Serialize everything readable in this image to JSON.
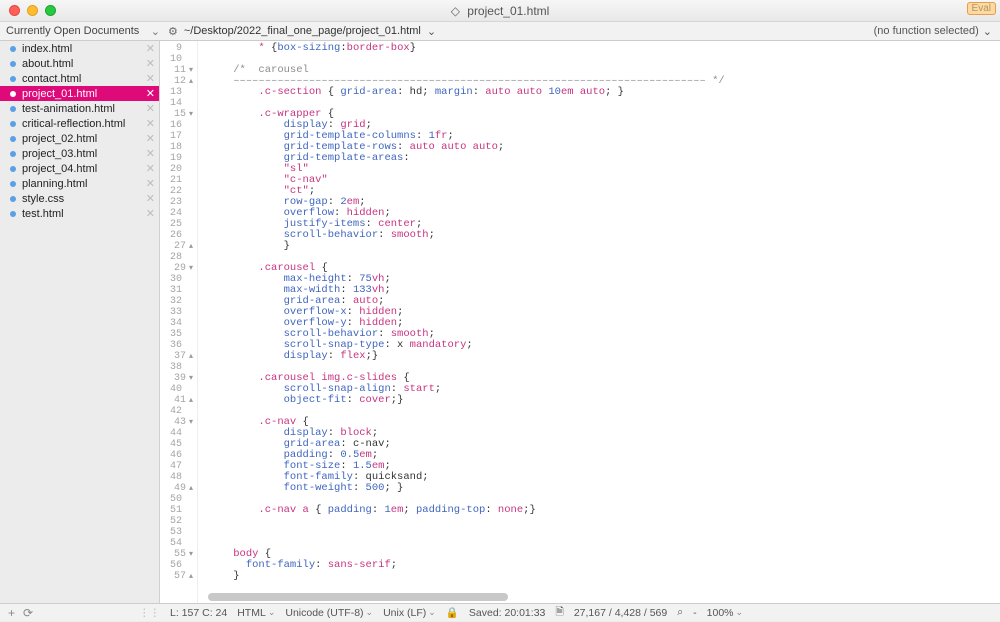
{
  "window": {
    "title": "project_01.html",
    "eval_label": "Eval"
  },
  "toolbar": {
    "sidebar_title": "Currently Open Documents",
    "path": "~/Desktop/2022_final_one_page/project_01.html",
    "func_selector": "(no function selected)"
  },
  "sidebar": {
    "files": [
      {
        "name": "index.html",
        "active": false
      },
      {
        "name": "about.html",
        "active": false
      },
      {
        "name": "contact.html",
        "active": false
      },
      {
        "name": "project_01.html",
        "active": true
      },
      {
        "name": "test-animation.html",
        "active": false
      },
      {
        "name": "critical-reflection.html",
        "active": false
      },
      {
        "name": "project_02.html",
        "active": false
      },
      {
        "name": "project_03.html",
        "active": false
      },
      {
        "name": "project_04.html",
        "active": false
      },
      {
        "name": "planning.html",
        "active": false
      },
      {
        "name": "style.css",
        "active": false
      },
      {
        "name": "test.html",
        "active": false
      }
    ]
  },
  "editor": {
    "first_line": 9,
    "fold_marks": {
      "11": "down",
      "12": "up",
      "15": "down",
      "27": "up",
      "29": "down",
      "37": "up",
      "39": "down",
      "41": "up",
      "43": "down",
      "49": "up",
      "55": "down",
      "57": "up"
    },
    "lines": [
      {
        "n": 9,
        "html": "        <span class='c-sel'>*</span> {<span class='c-prop'>box-sizing</span>:<span class='c-val'>border-box</span>}"
      },
      {
        "n": 10,
        "html": ""
      },
      {
        "n": 11,
        "html": "    <span class='c-com'>/*  carousel</span>"
      },
      {
        "n": 12,
        "html": "    <span class='c-com'>––––––––––––––––––––––––––––––––––––––––––––––––––––––––––––––––––––––––––– */</span>"
      },
      {
        "n": 13,
        "html": "        <span class='c-sel'>.c-section</span> { <span class='c-prop'>grid-area</span>: hd; <span class='c-prop'>margin</span>: <span class='c-val'>auto auto</span> <span class='c-num'>10</span><span class='c-unit'>em</span> <span class='c-val'>auto</span>; }"
      },
      {
        "n": 14,
        "html": ""
      },
      {
        "n": 15,
        "html": "        <span class='c-sel'>.c-wrapper</span> {"
      },
      {
        "n": 16,
        "html": "            <span class='c-prop'>display</span>: <span class='c-val'>grid</span>;"
      },
      {
        "n": 17,
        "html": "            <span class='c-prop'>grid-template-columns</span>: <span class='c-num'>1</span><span class='c-unit'>fr</span>;"
      },
      {
        "n": 18,
        "html": "            <span class='c-prop'>grid-template-rows</span>: <span class='c-val'>auto auto auto</span>;"
      },
      {
        "n": 19,
        "html": "            <span class='c-prop'>grid-template-areas</span>:"
      },
      {
        "n": 20,
        "html": "            <span class='c-str'>\"sl\"</span>"
      },
      {
        "n": 21,
        "html": "            <span class='c-str'>\"c-nav\"</span>"
      },
      {
        "n": 22,
        "html": "            <span class='c-str'>\"ct\"</span>;"
      },
      {
        "n": 23,
        "html": "            <span class='c-prop'>row-gap</span>: <span class='c-num'>2</span><span class='c-unit'>em</span>;"
      },
      {
        "n": 24,
        "html": "            <span class='c-prop'>overflow</span>: <span class='c-val'>hidden</span>;"
      },
      {
        "n": 25,
        "html": "            <span class='c-prop'>justify-items</span>: <span class='c-val'>center</span>;"
      },
      {
        "n": 26,
        "html": "            <span class='c-prop'>scroll-behavior</span>: <span class='c-val'>smooth</span>;"
      },
      {
        "n": 27,
        "html": "            }"
      },
      {
        "n": 28,
        "html": ""
      },
      {
        "n": 29,
        "html": "        <span class='c-sel'>.carousel</span> {"
      },
      {
        "n": 30,
        "html": "            <span class='c-prop'>max-height</span>: <span class='c-num'>75</span><span class='c-unit'>vh</span>;"
      },
      {
        "n": 31,
        "html": "            <span class='c-prop'>max-width</span>: <span class='c-num'>133</span><span class='c-unit'>vh</span>;"
      },
      {
        "n": 32,
        "html": "            <span class='c-prop'>grid-area</span>: <span class='c-val'>auto</span>;"
      },
      {
        "n": 33,
        "html": "            <span class='c-prop'>overflow-x</span>: <span class='c-val'>hidden</span>;"
      },
      {
        "n": 34,
        "html": "            <span class='c-prop'>overflow-y</span>: <span class='c-val'>hidden</span>;"
      },
      {
        "n": 35,
        "html": "            <span class='c-prop'>scroll-behavior</span>: <span class='c-val'>smooth</span>;"
      },
      {
        "n": 36,
        "html": "            <span class='c-prop'>scroll-snap-type</span>: x <span class='c-val'>mandatory</span>;"
      },
      {
        "n": 37,
        "html": "            <span class='c-prop'>display</span>: <span class='c-val'>flex</span>;}"
      },
      {
        "n": 38,
        "html": ""
      },
      {
        "n": 39,
        "html": "        <span class='c-sel'>.carousel img.c-slides</span> {"
      },
      {
        "n": 40,
        "html": "            <span class='c-prop'>scroll-snap-align</span>: <span class='c-val'>start</span>;"
      },
      {
        "n": 41,
        "html": "            <span class='c-prop'>object-fit</span>: <span class='c-val'>cover</span>;}"
      },
      {
        "n": 42,
        "html": ""
      },
      {
        "n": 43,
        "html": "        <span class='c-sel'>.c-nav</span> {"
      },
      {
        "n": 44,
        "html": "            <span class='c-prop'>display</span>: <span class='c-val'>block</span>;"
      },
      {
        "n": 45,
        "html": "            <span class='c-prop'>grid-area</span>: c-nav;"
      },
      {
        "n": 46,
        "html": "            <span class='c-prop'>padding</span>: <span class='c-num'>0.5</span><span class='c-unit'>em</span>;"
      },
      {
        "n": 47,
        "html": "            <span class='c-prop'>font-size</span>: <span class='c-num'>1.5</span><span class='c-unit'>em</span>;"
      },
      {
        "n": 48,
        "html": "            <span class='c-prop'>font-family</span>: quicksand;"
      },
      {
        "n": 49,
        "html": "            <span class='c-prop'>font-weight</span>: <span class='c-num'>500</span>; }"
      },
      {
        "n": 50,
        "html": ""
      },
      {
        "n": 51,
        "html": "        <span class='c-sel'>.c-nav a</span> { <span class='c-prop'>padding</span>: <span class='c-num'>1</span><span class='c-unit'>em</span>; <span class='c-prop'>padding-top</span>: <span class='c-val'>none</span>;}"
      },
      {
        "n": 52,
        "html": ""
      },
      {
        "n": 53,
        "html": ""
      },
      {
        "n": 54,
        "html": ""
      },
      {
        "n": 55,
        "html": "    <span class='c-sel'>body</span> {"
      },
      {
        "n": 56,
        "html": "      <span class='c-prop'>font-family</span>: <span class='c-val'>sans-serif</span>;"
      },
      {
        "n": 57,
        "html": "    }"
      }
    ]
  },
  "statusbar": {
    "位置": "L: 157 C: 24",
    "lang": "HTML",
    "encoding": "Unicode (UTF-8)",
    "line_endings": "Unix (LF)",
    "saved": "Saved: 20:01:33",
    "stats": "27,167 / 4,428 / 569",
    "search_icon": "⌕",
    "zoom": "100%"
  }
}
